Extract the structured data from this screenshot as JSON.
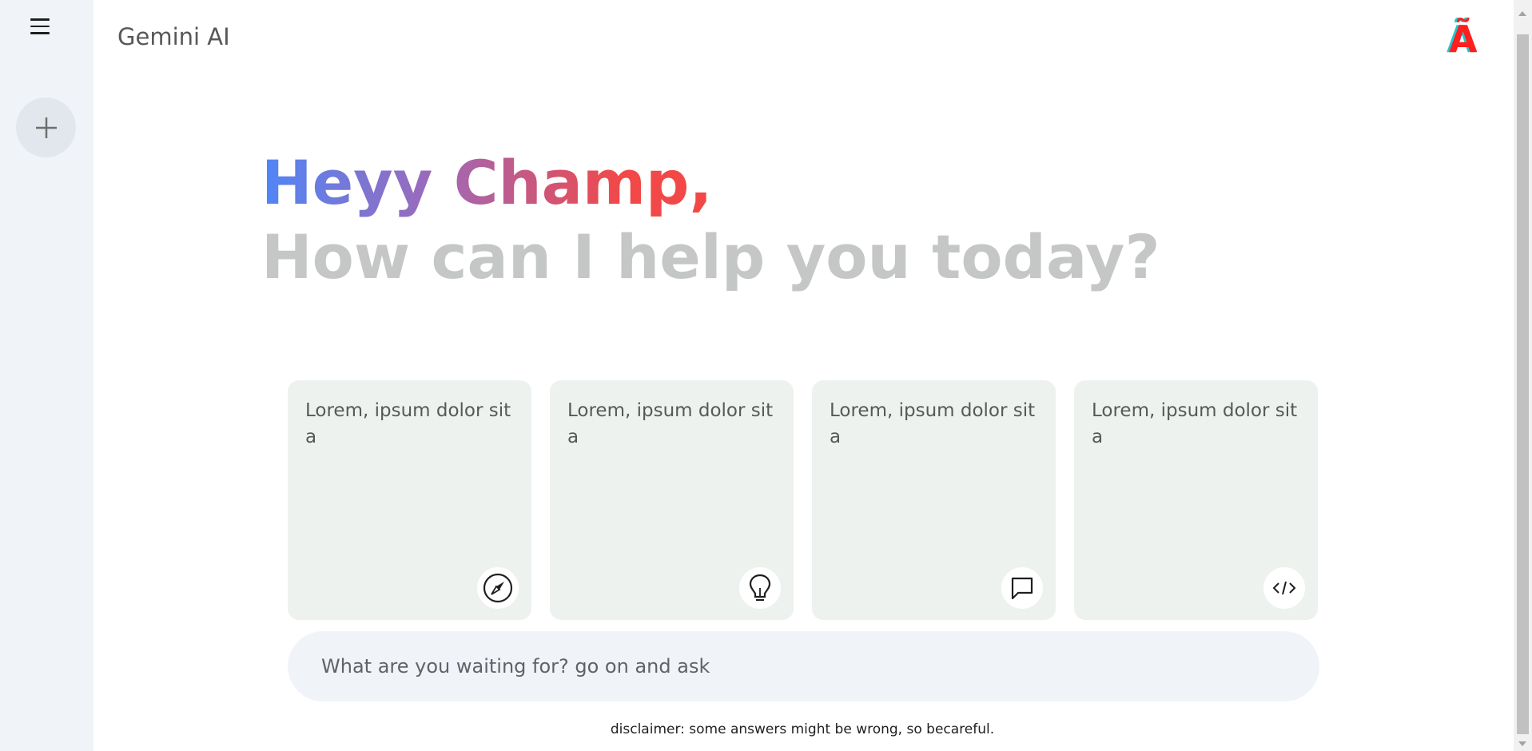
{
  "app": {
    "title": "Gemini AI",
    "avatar_text": "Ã"
  },
  "greeting": {
    "hello": "Heyy Champ,",
    "subtitle": "How can I help you today?"
  },
  "cards": [
    {
      "text": "Lorem, ipsum dolor sit a",
      "icon": "compass-icon"
    },
    {
      "text": "Lorem, ipsum dolor sit a",
      "icon": "bulb-icon"
    },
    {
      "text": "Lorem, ipsum dolor sit a",
      "icon": "message-icon"
    },
    {
      "text": "Lorem, ipsum dolor sit a",
      "icon": "code-icon"
    }
  ],
  "search": {
    "placeholder": "What are you waiting for? go on and ask"
  },
  "disclaimer": "disclaimer: some answers might be wrong, so becareful.",
  "colors": {
    "sidebar": "#f0f4f9",
    "card": "#eef2ef",
    "gradient_start": "#4f86f7",
    "gradient_end": "#f24848"
  }
}
